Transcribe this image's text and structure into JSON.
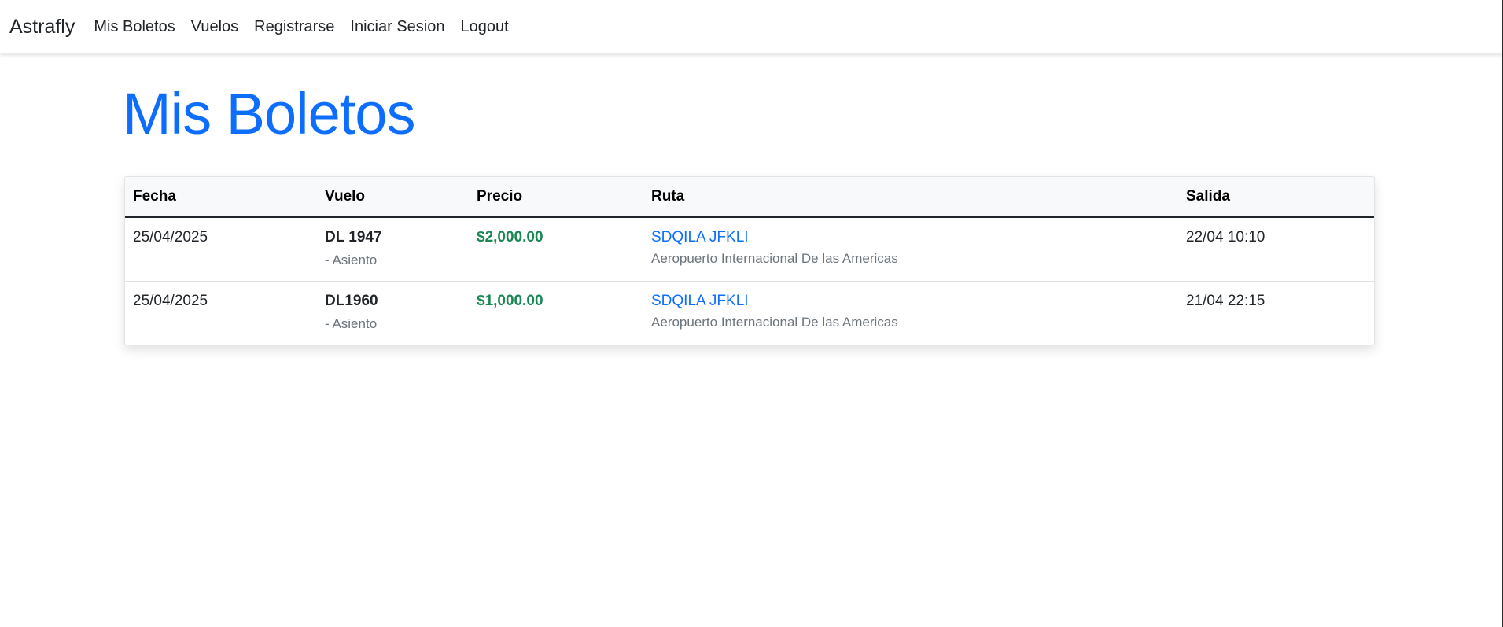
{
  "navbar": {
    "brand": "Astrafly",
    "links": [
      "Mis Boletos",
      "Vuelos",
      "Registrarse",
      "Iniciar Sesion",
      "Logout"
    ]
  },
  "page": {
    "title": "Mis Boletos"
  },
  "table": {
    "headers": [
      "Fecha",
      "Vuelo",
      "Precio",
      "Ruta",
      "Salida"
    ],
    "rows": [
      {
        "fecha": "25/04/2025",
        "vuelo": "DL 1947",
        "asiento": "- Asiento",
        "precio": "$2,000.00",
        "ruta": "SDQILA JFKLI",
        "aeropuerto": "Aeropuerto Internacional De las Americas",
        "salida": "22/04 10:10"
      },
      {
        "fecha": "25/04/2025",
        "vuelo": "DL1960",
        "asiento": "- Asiento",
        "precio": "$1,000.00",
        "ruta": "SDQILA JFKLI",
        "aeropuerto": "Aeropuerto Internacional De las Americas",
        "salida": "21/04 22:15"
      }
    ]
  },
  "colors": {
    "primary": "#0d6efd",
    "price": "#198754",
    "muted": "#6c757d",
    "text": "#212529"
  }
}
